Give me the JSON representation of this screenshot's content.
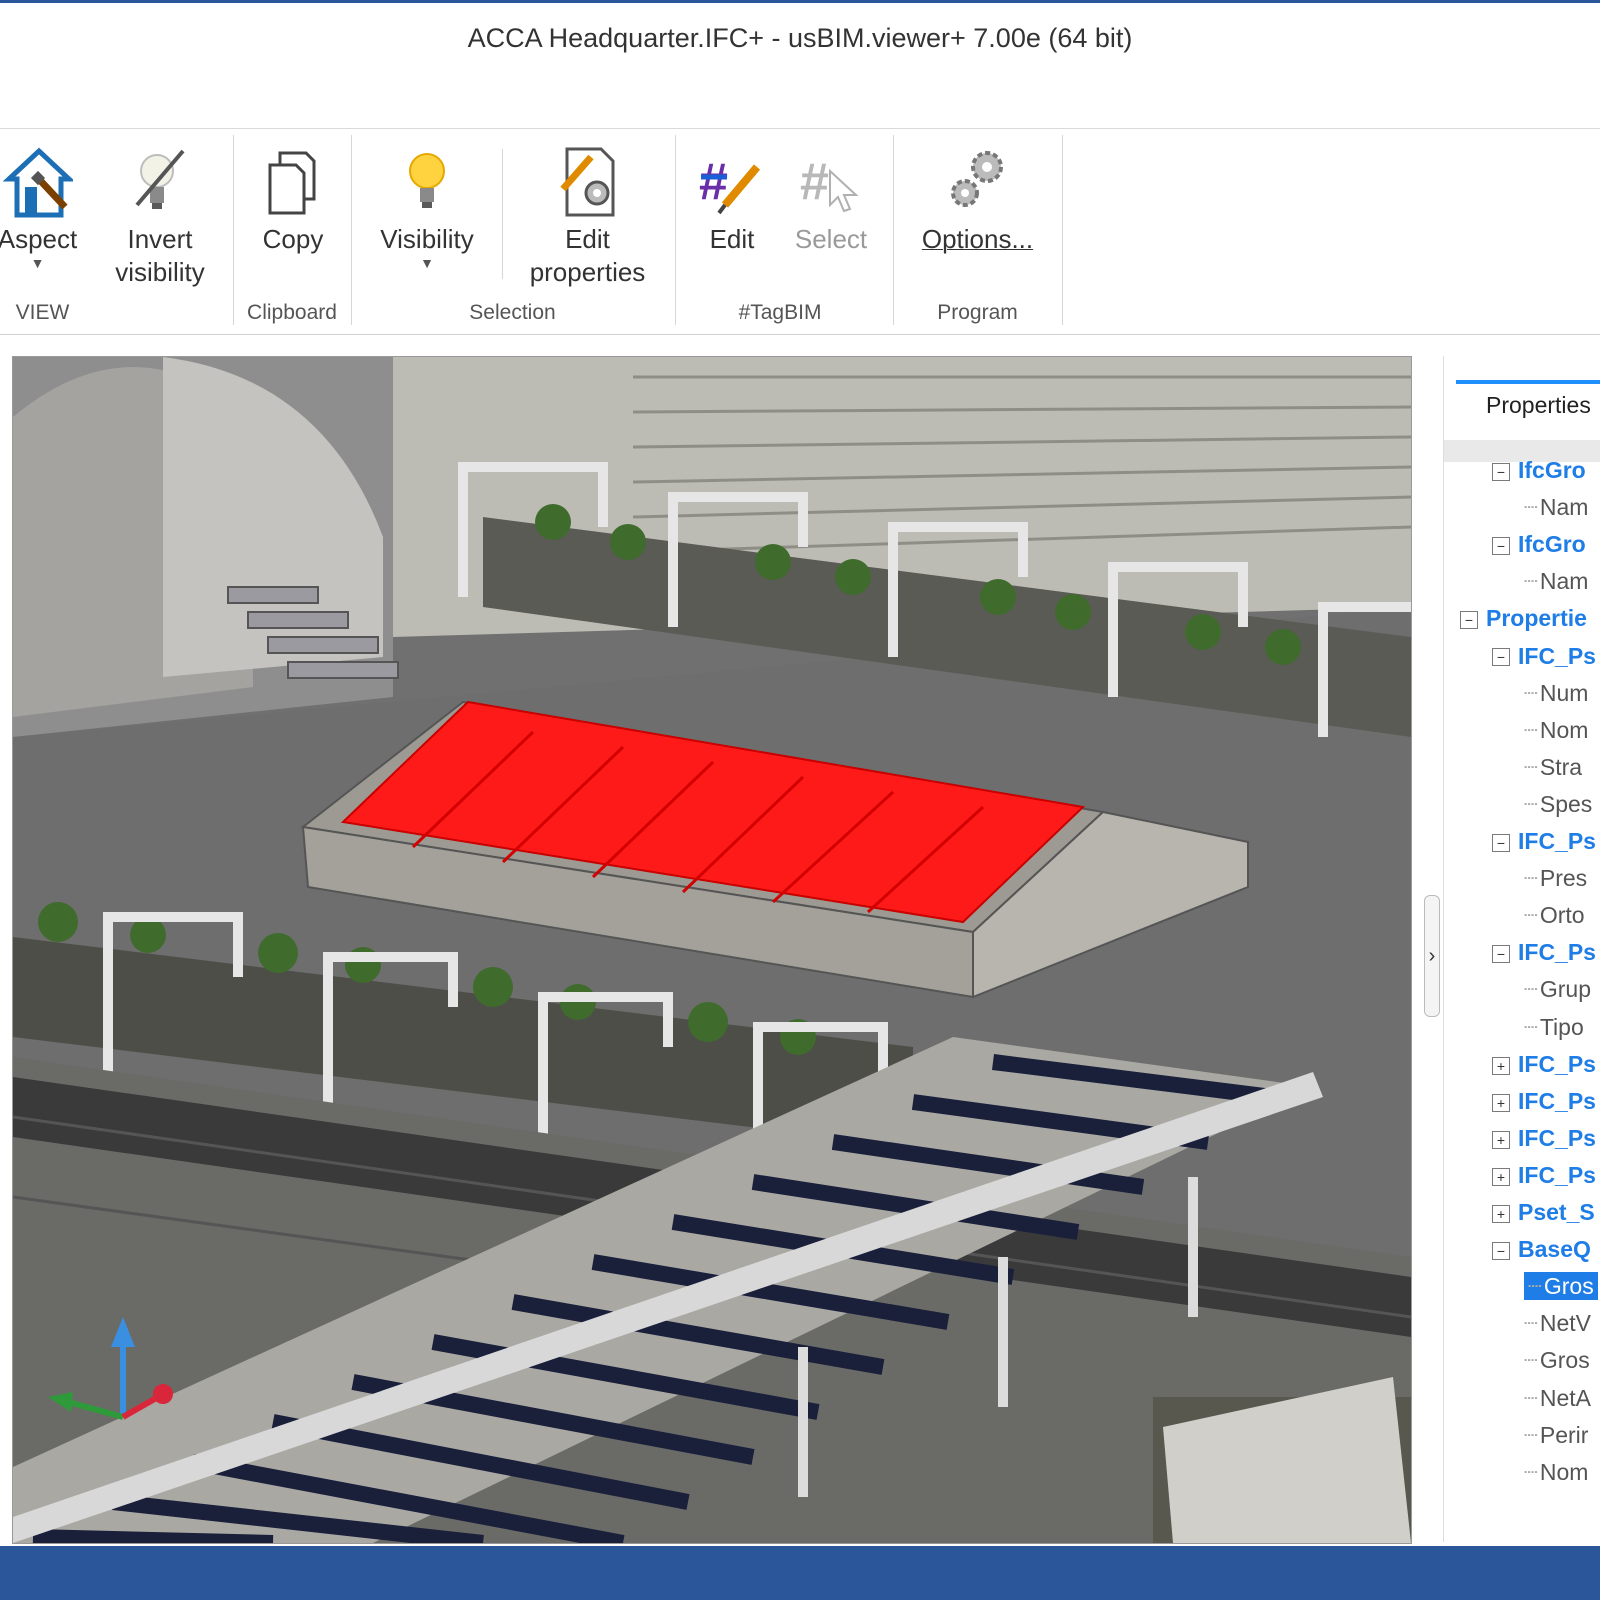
{
  "window": {
    "title": "ACCA Headquarter.IFC+  -  usBIM.viewer+  7.00e (64 bit)"
  },
  "ribbon": {
    "groups": [
      {
        "label": "VIEW",
        "buttons": [
          {
            "label": "Aspect",
            "icon": "house-brush-icon"
          },
          {
            "label": "Invert visibility",
            "icon": "lightbulb-off-icon"
          }
        ]
      },
      {
        "label": "Clipboard",
        "buttons": [
          {
            "label": "Copy",
            "icon": "copy-icon"
          }
        ]
      },
      {
        "label": "Selection",
        "buttons": [
          {
            "label": "Visibility",
            "icon": "lightbulb-icon"
          },
          {
            "label": "Edit properties",
            "icon": "edit-document-icon"
          }
        ]
      },
      {
        "label": "#TagBIM",
        "buttons": [
          {
            "label": "Edit",
            "icon": "tag-edit-icon"
          },
          {
            "label": "Select",
            "icon": "tag-select-icon"
          }
        ]
      },
      {
        "label": "Program",
        "buttons": [
          {
            "label": "Options...",
            "icon": "gears-icon"
          }
        ]
      }
    ]
  },
  "colors": {
    "accent": "#2b579a",
    "selection": "#ff1a1a",
    "tree_node": "#1e7de6"
  },
  "panel": {
    "tab_label": "Properties",
    "tree": [
      {
        "label": "IfcGro",
        "type": "node",
        "toggle": "−"
      },
      {
        "label": "Nam",
        "type": "leaf"
      },
      {
        "label": "IfcGro",
        "type": "node",
        "toggle": "−"
      },
      {
        "label": "Nam",
        "type": "leaf"
      },
      {
        "label": "Propertie",
        "type": "node",
        "toggle": "−"
      },
      {
        "label": "IFC_Ps",
        "type": "node",
        "toggle": "−"
      },
      {
        "label": "Num",
        "type": "leaf"
      },
      {
        "label": "Nom",
        "type": "leaf"
      },
      {
        "label": "Stra",
        "type": "leaf"
      },
      {
        "label": "Spes",
        "type": "leaf"
      },
      {
        "label": "IFC_Ps",
        "type": "node",
        "toggle": "−"
      },
      {
        "label": "Pres",
        "type": "leaf"
      },
      {
        "label": "Orto",
        "type": "leaf"
      },
      {
        "label": "IFC_Ps",
        "type": "node",
        "toggle": "−"
      },
      {
        "label": "Grup",
        "type": "leaf"
      },
      {
        "label": "Tipo",
        "type": "leaf"
      },
      {
        "label": "IFC_Ps",
        "type": "node",
        "toggle": "+"
      },
      {
        "label": "IFC_Ps",
        "type": "node",
        "toggle": "+"
      },
      {
        "label": "IFC_Ps",
        "type": "node",
        "toggle": "+"
      },
      {
        "label": "IFC_Ps",
        "type": "node",
        "toggle": "+"
      },
      {
        "label": "Pset_S",
        "type": "node",
        "toggle": "+"
      },
      {
        "label": "BaseQ",
        "type": "node",
        "toggle": "−"
      },
      {
        "label": "Gros",
        "type": "leaf",
        "selected": true
      },
      {
        "label": "NetV",
        "type": "leaf"
      },
      {
        "label": "Gros",
        "type": "leaf"
      },
      {
        "label": "NetA",
        "type": "leaf"
      },
      {
        "label": "Perir",
        "type": "leaf"
      },
      {
        "label": "Nom",
        "type": "leaf"
      }
    ]
  },
  "splitter": {
    "icon": "chevron-right-icon",
    "glyph": "›"
  }
}
